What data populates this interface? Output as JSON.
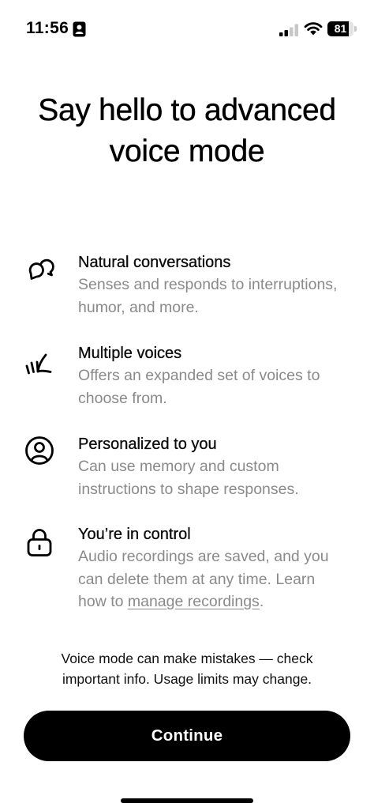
{
  "status_bar": {
    "time": "11:56",
    "focus_icon": "person-card-icon",
    "signal_icon": "cellular-signal-icon",
    "signal_bars_active": 2,
    "signal_bars_total": 4,
    "wifi_icon": "wifi-icon",
    "battery_level": "81",
    "battery_fraction": 0.81
  },
  "title": "Say hello to advanced voice mode",
  "features": [
    {
      "icon": "speech-bubbles-icon",
      "title": "Natural conversations",
      "description": "Senses and responds to interruptions, humor, and more."
    },
    {
      "icon": "voice-waves-icon",
      "title": "Multiple voices",
      "description": "Offers an expanded set of voices to choose from."
    },
    {
      "icon": "user-circle-icon",
      "title": "Personalized to you",
      "description": "Can use memory and custom instructions to shape responses."
    },
    {
      "icon": "lock-icon",
      "title": "You’re in control",
      "description": "Audio recordings are saved, and you can delete them at any time.",
      "learn_more_prefix": "Learn how to ",
      "learn_more_link": "manage recordings",
      "learn_more_suffix": "."
    }
  ],
  "disclaimer": "Voice mode can make mistakes — check important info. Usage limits may change.",
  "continue_label": "Continue",
  "colors": {
    "background": "#ffffff",
    "primary_text": "#000000",
    "secondary_text": "#8a8a8a",
    "button_background": "#000000",
    "button_text": "#ffffff"
  }
}
